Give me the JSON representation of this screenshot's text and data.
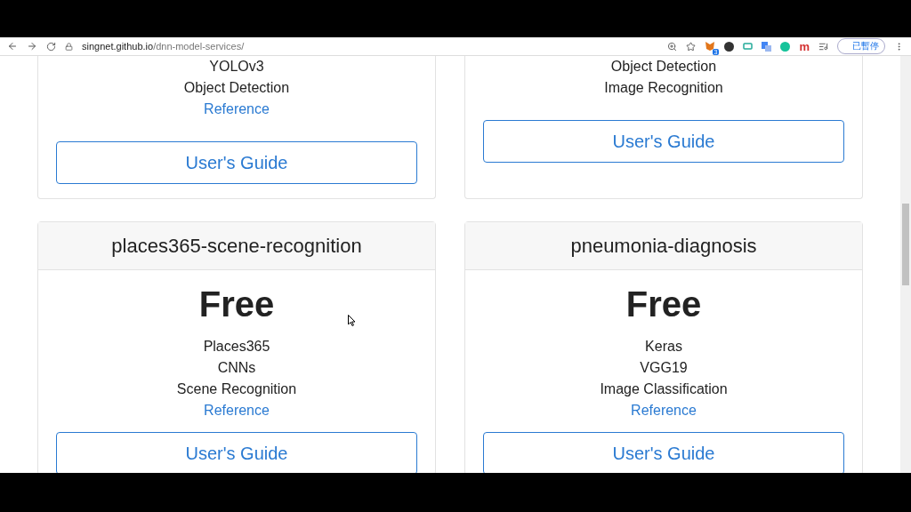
{
  "browser": {
    "url_host": "singnet.github.io",
    "url_path": "/dnn-model-services/",
    "extension_badge": "3",
    "extension_letter": "m",
    "profile_label": "已暫停"
  },
  "top_cards": [
    {
      "lines": [
        "YOLOv3",
        "Object Detection"
      ],
      "link": "Reference",
      "button": "User's Guide"
    },
    {
      "lines": [
        "Object Detection",
        "Image Recognition"
      ],
      "button": "User's Guide"
    }
  ],
  "cards": [
    {
      "title": "places365-scene-recognition",
      "price": "Free",
      "lines": [
        "Places365",
        "CNNs",
        "Scene Recognition"
      ],
      "link": "Reference",
      "button": "User's Guide"
    },
    {
      "title": "pneumonia-diagnosis",
      "price": "Free",
      "lines": [
        "Keras",
        "VGG19",
        "Image Classification"
      ],
      "link": "Reference",
      "button": "User's Guide"
    }
  ]
}
